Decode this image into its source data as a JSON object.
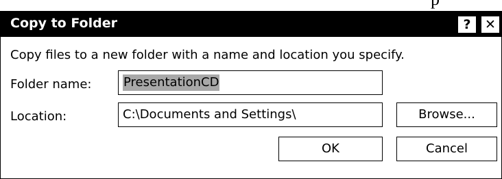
{
  "page_edge_text": "p",
  "dialog": {
    "title": "Copy to Folder",
    "help_label": "?",
    "close_label": "✕",
    "description": "Copy files to a new folder with a name and location you specify.",
    "folder_name_label": "Folder name:",
    "folder_name_value": "PresentationCD",
    "location_label": "Location:",
    "location_value": "C:\\Documents and Settings\\",
    "browse_label": "Browse...",
    "ok_label": "OK",
    "cancel_label": "Cancel"
  }
}
